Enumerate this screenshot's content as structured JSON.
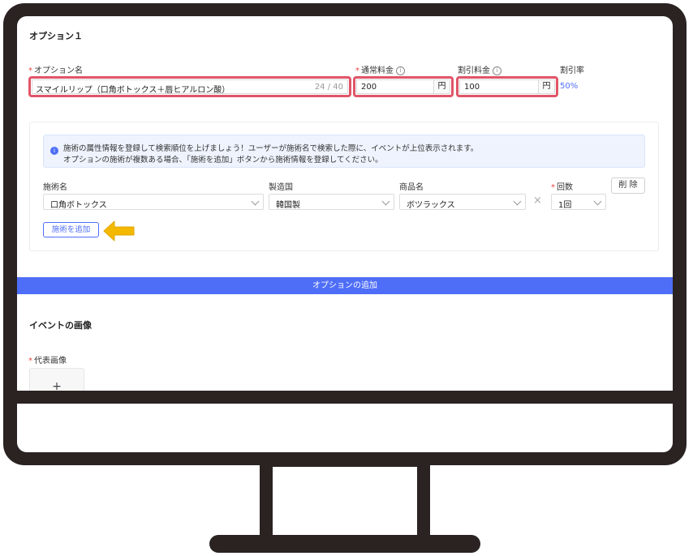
{
  "option": {
    "heading": "オプション１",
    "name_label": "オプション名",
    "name_value": "スマイルリップ（口角ボトックス＋唇ヒアルロン酸）",
    "name_counter": "24 / 40",
    "regular_price_label": "通常料金",
    "regular_price_value": "200",
    "regular_price_unit": "円",
    "discount_price_label": "割引料金",
    "discount_price_value": "100",
    "discount_price_unit": "円",
    "discount_rate_label": "割引率",
    "discount_rate_value": "50%"
  },
  "notice": {
    "line1": "施術の属性情報を登録して検索順位を上げましょう！ユーザーが施術名で検索した際に、イベントが上位表示されます。",
    "line2": "オプションの施術が複数ある場合、「施術を追加」ボタンから施術情報を登録してください。"
  },
  "treatment": {
    "name_label": "施術名",
    "name_value": "口角ボトックス",
    "country_label": "製造国",
    "country_value": "韓国製",
    "product_label": "商品名",
    "product_value": "ボツラックス",
    "count_label": "回数",
    "count_value": "1回",
    "delete_label": "削 除",
    "add_label": "施術を追加"
  },
  "add_option_label": "オプションの追加",
  "event_image": {
    "heading": "イベントの画像",
    "main_label": "代表画像",
    "upload_symbol": "+"
  },
  "colors": {
    "accent": "#4f6ef7",
    "highlight": "#e05568",
    "arrow": "#f5b800",
    "frame": "#2a2322"
  }
}
